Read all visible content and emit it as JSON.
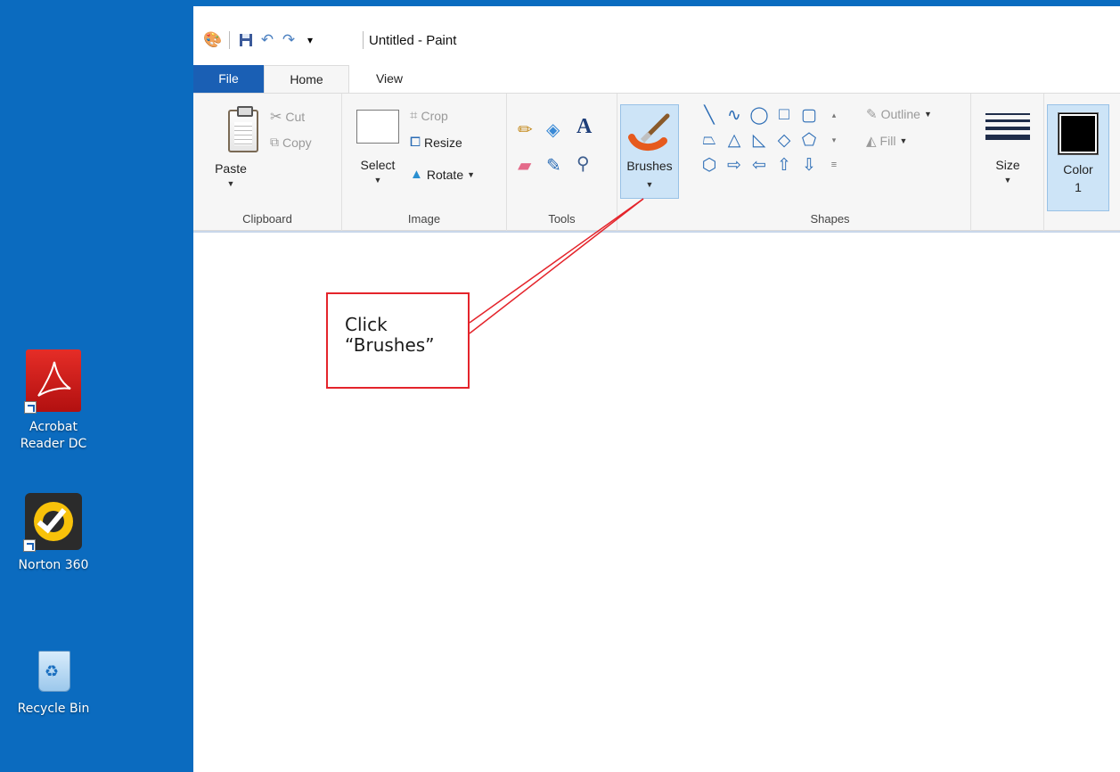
{
  "desktop": {
    "icons": [
      {
        "label_line1": "Acrobat",
        "label_line2": "Reader DC",
        "icon": "acrobat-reader-icon"
      },
      {
        "label_line1": "Norton 360",
        "icon": "norton-360-icon"
      },
      {
        "label_line1": "Recycle Bin",
        "icon": "recycle-bin-icon"
      }
    ]
  },
  "window": {
    "title": "Untitled - Paint",
    "qat_icons": [
      "paint-app-icon",
      "save-icon",
      "undo-icon",
      "redo-icon",
      "customize-qat-icon"
    ]
  },
  "tabs": {
    "file": "File",
    "home": "Home",
    "view": "View"
  },
  "ribbon": {
    "clipboard": {
      "label": "Clipboard",
      "paste": "Paste",
      "cut": "Cut",
      "copy": "Copy"
    },
    "image": {
      "label": "Image",
      "select": "Select",
      "crop": "Crop",
      "resize": "Resize",
      "rotate": "Rotate"
    },
    "tools": {
      "label": "Tools"
    },
    "brushes": {
      "label": "Brushes"
    },
    "shapes": {
      "label": "Shapes",
      "outline": "Outline",
      "fill": "Fill"
    },
    "size": {
      "label": "Size"
    },
    "color1": {
      "label_line1": "Color",
      "label_line2": "1",
      "value": "#000000"
    }
  },
  "annotation": {
    "line1": "Click",
    "line2": "“Brushes”"
  },
  "colors": {
    "desktop": "#0b6bbf",
    "file_tab": "#1a5fb4",
    "annotation": "#e4242b",
    "selected_button": "#cde4f7"
  }
}
